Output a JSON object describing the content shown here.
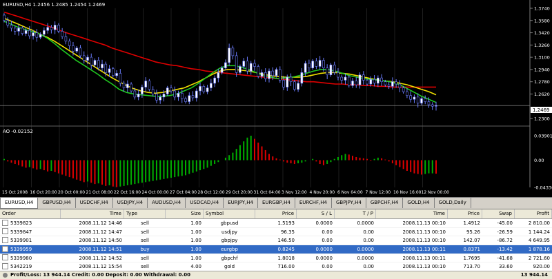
{
  "colors": {
    "background": "#000000",
    "grid": "#1e1e1e",
    "bull_candle": "#ffffff",
    "bear_candle": "#ffffff",
    "candle_outline": "#6b7cff",
    "ma_slow": "#e00000",
    "ma_mid": "#f0e000",
    "ma_fast": "#20c820",
    "ao_up": "#00b000",
    "ao_down": "#e00000",
    "text": "#ffffff",
    "selected_row": "#316ac5"
  },
  "chart": {
    "header": "EURUSD,H4  1.2456 1.2485 1.2454 1.2469",
    "price_axis": [
      "1.3740",
      "1.3580",
      "1.3420",
      "1.3260",
      "1.3100",
      "1.2940",
      "1.2780",
      "1.2620",
      "1.2469",
      "1.2300"
    ],
    "current_price": "1.2469",
    "ao_header": "AO -0.02152",
    "ao_axis": [
      "0.03901",
      "0.00",
      "-0.04336"
    ],
    "time_axis": [
      "15 Oct 2008",
      "16 Oct 20:00",
      "20 Oct 00:00",
      "21 Oct 08:00",
      "22 Oct 16:00",
      "24 Oct 00:00",
      "27 Oct 04:00",
      "28 Oct 12:00",
      "29 Oct 20:00",
      "31 Oct 04:00",
      "3 Nov 12:00",
      "4 Nov 20:00",
      "6 Nov 04:00",
      "7 Nov 12:00",
      "10 Nov 16:00",
      "12 Nov 00:00"
    ]
  },
  "chart_data": {
    "type": "candlestick",
    "symbol": "EURUSD",
    "timeframe": "H4",
    "price_range": [
      1.23,
      1.374
    ],
    "closes": [
      1.358,
      1.352,
      1.348,
      1.344,
      1.348,
      1.341,
      1.345,
      1.338,
      1.342,
      1.336,
      1.34,
      1.345,
      1.349,
      1.346,
      1.352,
      1.344,
      1.337,
      1.331,
      1.325,
      1.318,
      1.322,
      1.312,
      1.306,
      1.31,
      1.3,
      1.306,
      1.296,
      1.301,
      1.29,
      1.295,
      1.286,
      1.289,
      1.276,
      1.27,
      1.275,
      1.266,
      1.258,
      1.262,
      1.271,
      1.279,
      1.268,
      1.262,
      1.254,
      1.258,
      1.262,
      1.27,
      1.266,
      1.258,
      1.263,
      1.256,
      1.252,
      1.26,
      1.257,
      1.266,
      1.272,
      1.265,
      1.27,
      1.276,
      1.283,
      1.29,
      1.296,
      1.303,
      1.322,
      1.312,
      1.29,
      1.298,
      1.305,
      1.292,
      1.302,
      1.298,
      1.285,
      1.29,
      1.282,
      1.292,
      1.286,
      1.294,
      1.28,
      1.271,
      1.284,
      1.278,
      1.268,
      1.276,
      1.29,
      1.302,
      1.296,
      1.305,
      1.298,
      1.306,
      1.296,
      1.287,
      1.3,
      1.29,
      1.284,
      1.28,
      1.284,
      1.273,
      1.279,
      1.274,
      1.287,
      1.28,
      1.275,
      1.281,
      1.276,
      1.283,
      1.278,
      1.274,
      1.272,
      1.278,
      1.275,
      1.27,
      1.265,
      1.26,
      1.255,
      1.258,
      1.25,
      1.256,
      1.252,
      1.248,
      1.246,
      1.2469
    ],
    "moving_averages": [
      {
        "color": "#e00000",
        "values": [
          1.369,
          1.366,
          1.363,
          1.36,
          1.357,
          1.354,
          1.351,
          1.348,
          1.344,
          1.341,
          1.338,
          1.335,
          1.332,
          1.329,
          1.326,
          1.322,
          1.319,
          1.316,
          1.313,
          1.31,
          1.307,
          1.304,
          1.302,
          1.3,
          1.299,
          1.297,
          1.295,
          1.294,
          1.292,
          1.291,
          1.29,
          1.289,
          1.288,
          1.287,
          1.286,
          1.285,
          1.284,
          1.283,
          1.282,
          1.281,
          1.28,
          1.279,
          1.278,
          1.278,
          1.277,
          1.276,
          1.275,
          1.275,
          1.274,
          1.274,
          1.273,
          1.273,
          1.272,
          1.272,
          1.271,
          1.271,
          1.271,
          1.271,
          1.271,
          1.271,
          1.271
        ]
      },
      {
        "color": "#f0e000",
        "values": [
          1.361,
          1.357,
          1.353,
          1.349,
          1.345,
          1.34,
          1.336,
          1.331,
          1.325,
          1.319,
          1.313,
          1.307,
          1.301,
          1.295,
          1.289,
          1.283,
          1.278,
          1.273,
          1.269,
          1.266,
          1.264,
          1.263,
          1.264,
          1.266,
          1.268,
          1.27,
          1.274,
          1.278,
          1.283,
          1.288,
          1.292,
          1.294,
          1.294,
          1.293,
          1.292,
          1.29,
          1.288,
          1.286,
          1.285,
          1.284,
          1.284,
          1.284,
          1.285,
          1.287,
          1.289,
          1.29,
          1.29,
          1.289,
          1.288,
          1.286,
          1.284,
          1.282,
          1.28,
          1.279,
          1.278,
          1.276,
          1.274,
          1.271,
          1.268,
          1.265,
          1.261
        ]
      },
      {
        "color": "#20c820",
        "values": [
          1.357,
          1.353,
          1.349,
          1.346,
          1.343,
          1.34,
          1.335,
          1.328,
          1.32,
          1.313,
          1.306,
          1.3,
          1.294,
          1.288,
          1.281,
          1.275,
          1.268,
          1.264,
          1.262,
          1.261,
          1.26,
          1.259,
          1.259,
          1.26,
          1.262,
          1.266,
          1.27,
          1.276,
          1.283,
          1.29,
          1.296,
          1.299,
          1.299,
          1.297,
          1.294,
          1.29,
          1.286,
          1.284,
          1.282,
          1.283,
          1.284,
          1.286,
          1.289,
          1.292,
          1.294,
          1.294,
          1.292,
          1.289,
          1.286,
          1.284,
          1.282,
          1.281,
          1.28,
          1.279,
          1.277,
          1.274,
          1.269,
          1.264,
          1.259,
          1.255,
          1.251
        ]
      }
    ],
    "ao": {
      "range": [
        -0.04336,
        0.03901
      ],
      "values": [
        0.002,
        -0.002,
        -0.004,
        -0.006,
        -0.008,
        -0.01,
        -0.012,
        -0.011,
        -0.013,
        -0.015,
        -0.014,
        -0.016,
        -0.018,
        -0.017,
        -0.019,
        -0.021,
        -0.023,
        -0.025,
        -0.027,
        -0.029,
        -0.031,
        -0.033,
        -0.035,
        -0.034,
        -0.036,
        -0.038,
        -0.037,
        -0.039,
        -0.041,
        -0.04,
        -0.042,
        -0.043,
        -0.042,
        -0.041,
        -0.04,
        -0.039,
        -0.038,
        -0.037,
        -0.036,
        -0.035,
        -0.034,
        -0.033,
        -0.032,
        -0.031,
        -0.03,
        -0.029,
        -0.028,
        -0.027,
        -0.026,
        -0.025,
        -0.024,
        -0.022,
        -0.02,
        -0.018,
        -0.016,
        -0.014,
        -0.012,
        -0.009,
        -0.006,
        -0.003,
        0.0,
        0.004,
        0.008,
        0.012,
        0.018,
        0.024,
        0.03,
        0.036,
        0.039,
        0.034,
        0.028,
        0.022,
        0.016,
        0.01,
        0.006,
        0.003,
        0.001,
        -0.002,
        -0.004,
        -0.005,
        -0.006,
        -0.005,
        -0.004,
        -0.002,
        0.0,
        0.002,
        -0.002,
        -0.006,
        -0.008,
        -0.006,
        -0.003,
        0.002,
        0.005,
        0.008,
        0.01,
        0.009,
        0.007,
        0.005,
        0.004,
        0.003,
        0.002,
        -0.001,
        0.002,
        0.004,
        0.003,
        0.001,
        -0.002,
        -0.005,
        -0.008,
        -0.011,
        -0.014,
        -0.017,
        -0.019,
        -0.021,
        -0.022,
        -0.023,
        -0.022,
        -0.021,
        -0.021,
        -0.02152
      ]
    }
  },
  "tabs": [
    "EURUSD,H4",
    "GBPUSD,H4",
    "USDCHF,H4",
    "USDJPY,H4",
    "AUDUSD,H4",
    "USDCAD,H4",
    "EURJPY,H4",
    "EURGBP,H4",
    "EURCHF,H4",
    "GBPJPY,H4",
    "GBPCHF,H4",
    "GOLD,H4",
    "GOLD,Daily"
  ],
  "active_tab": 0,
  "terminal": {
    "columns": [
      "Order",
      "Time",
      "Type",
      "Size",
      "Symbol",
      "Price",
      "S / L",
      "T / P",
      "Time",
      "Price",
      "Swap",
      "Profit"
    ],
    "rows": [
      [
        "5339823",
        "2008.11.12 14:46",
        "sell",
        "1.00",
        "gbpusd",
        "1.5193",
        "0.0000",
        "0.0000",
        "2008.11.13 00:10",
        "1.4912",
        "-45.00",
        "2 810.00"
      ],
      [
        "5339847",
        "2008.11.12 14:47",
        "sell",
        "1.00",
        "usdjpy",
        "96.35",
        "0.00",
        "0.00",
        "2008.11.13 00:10",
        "95.26",
        "-26.59",
        "1 144.24"
      ],
      [
        "5339901",
        "2008.11.12 14:50",
        "sell",
        "1.00",
        "gbpjpy",
        "146.50",
        "0.00",
        "0.00",
        "2008.11.13 00:10",
        "142.07",
        "-86.72",
        "4 649.95"
      ],
      [
        "5339959",
        "2008.11.12 14:51",
        "buy",
        "1.00",
        "eurgbp",
        "0.8245",
        "0.0000",
        "0.0000",
        "2008.11.13 00:11",
        "0.8371",
        "-13.42",
        "1 878.16"
      ],
      [
        "5339980",
        "2008.11.12 14:52",
        "sell",
        "1.00",
        "gbpchf",
        "1.8018",
        "0.0000",
        "0.0000",
        "2008.11.13 00:11",
        "1.7695",
        "-41.68",
        "2 721.60"
      ],
      [
        "5342219",
        "2008.11.12 15:54",
        "sell",
        "4.00",
        "gold",
        "716.00",
        "0.00",
        "0.00",
        "2008.11.13 00:10",
        "713.70",
        "33.60",
        "920.00"
      ]
    ],
    "selected_row": 3,
    "summary_label": "Profit/Loss: 13 944.14  Credit: 0.00  Deposit: 0.00  Withdrawal: 0.00",
    "summary_total": "13 944.14"
  }
}
